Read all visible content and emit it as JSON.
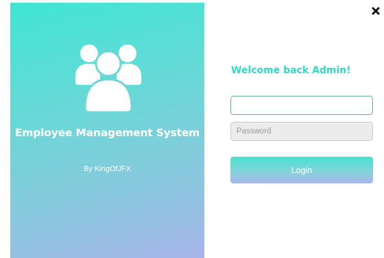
{
  "sidebar": {
    "title": "Employee Management System",
    "author": "By KingOfJFX",
    "icon": "users-group-icon",
    "gradient_colors": [
      "#3fe6d4",
      "#a8b4ea"
    ]
  },
  "window": {
    "close_icon": "close-icon"
  },
  "login_form": {
    "welcome_text": "Welcome back Admin!",
    "username_value": "",
    "password_placeholder": "Password",
    "login_label": "Login",
    "accent_color": "#35d7c6"
  }
}
